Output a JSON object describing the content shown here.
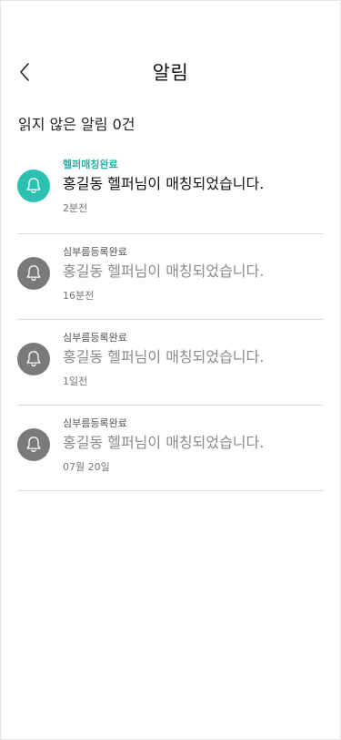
{
  "header": {
    "title": "알림"
  },
  "summary": {
    "text": "읽지 않은 알림 0건"
  },
  "notifications": [
    {
      "category": "헬퍼매칭완료",
      "message": "홍길동 헬퍼님이 매칭되었습니다.",
      "time": "2분전",
      "status": "unread",
      "icon": "bell-icon"
    },
    {
      "category": "심부름등록완료",
      "message": "홍길동 헬퍼님이 매칭되었습니다.",
      "time": "16분전",
      "status": "read",
      "icon": "bell-icon"
    },
    {
      "category": "심부름등록완료",
      "message": "홍길동 헬퍼님이 매칭되었습니다.",
      "time": "1일전",
      "status": "read",
      "icon": "bell-icon"
    },
    {
      "category": "심부름등록완료",
      "message": "홍길동 헬퍼님이 매칭되었습니다.",
      "time": "07월 20일",
      "status": "read",
      "icon": "bell-icon"
    }
  ],
  "colors": {
    "accent": "#2bc1b1",
    "inactive_icon": "#7a7a7a",
    "divider": "#dcdcdc"
  }
}
